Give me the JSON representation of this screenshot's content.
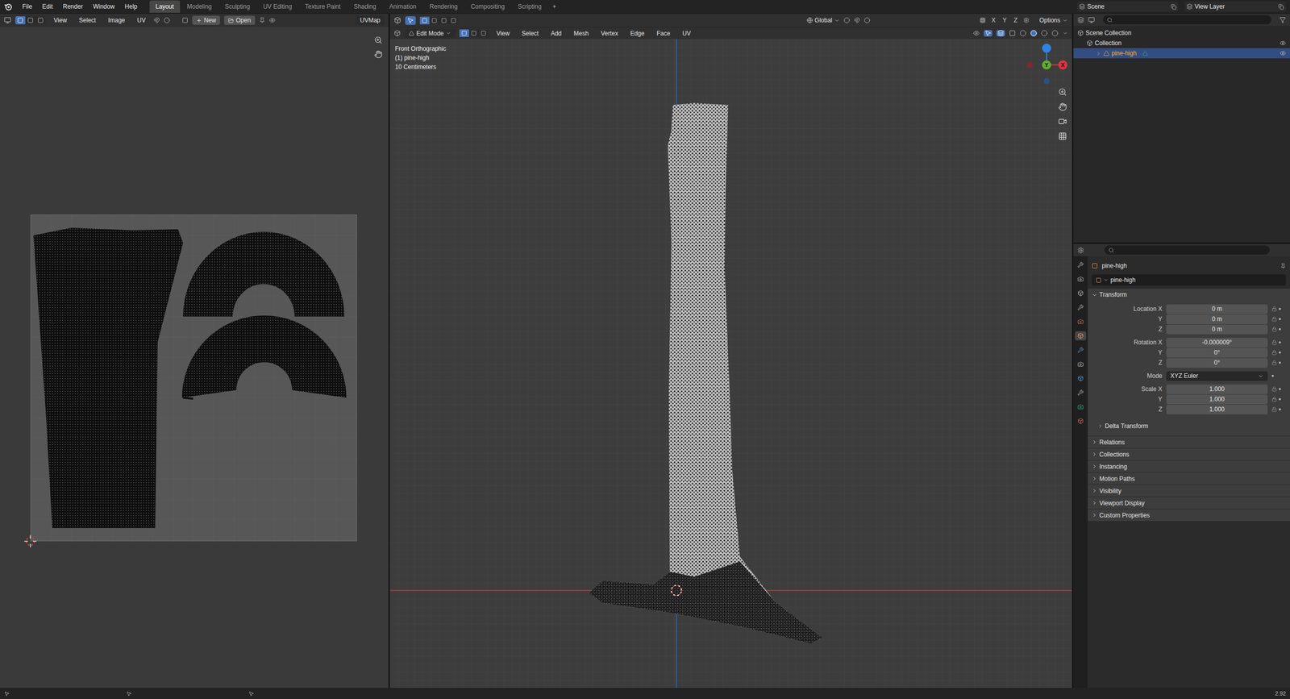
{
  "menu": [
    "File",
    "Edit",
    "Render",
    "Window",
    "Help"
  ],
  "workspaces": [
    {
      "label": "Layout",
      "selected": true
    },
    {
      "label": "Modeling",
      "selected": false
    },
    {
      "label": "Sculpting",
      "selected": false
    },
    {
      "label": "UV Editing",
      "selected": false
    },
    {
      "label": "Texture Paint",
      "selected": false
    },
    {
      "label": "Shading",
      "selected": false
    },
    {
      "label": "Animation",
      "selected": false
    },
    {
      "label": "Rendering",
      "selected": false
    },
    {
      "label": "Compositing",
      "selected": false
    },
    {
      "label": "Scripting",
      "selected": false
    }
  ],
  "add_workspace": "+",
  "scene": "Scene",
  "view_layer": "View Layer",
  "uv_editor": {
    "menu": [
      "View",
      "Select",
      "Image",
      "UV"
    ],
    "new_button": "New",
    "open_button": "Open",
    "uv_map": "UVMap"
  },
  "viewport": {
    "orientation": "Global",
    "mirror_axes": [
      "X",
      "Y",
      "Z"
    ],
    "options": "Options",
    "mode": "Edit Mode",
    "menu": [
      "View",
      "Select",
      "Add",
      "Mesh",
      "Vertex",
      "Edge",
      "Face",
      "UV"
    ],
    "overlay": [
      "Front Orthographic",
      "(1) pine-high",
      "10 Centimeters"
    ],
    "gizmo": [
      {
        "label": "Z",
        "color": "#2f84e3",
        "visible_label": false
      },
      {
        "label": "Y",
        "color": "#5fae2c",
        "visible_label": true
      },
      {
        "label": "X",
        "color": "#e0333f",
        "visible_label": true
      }
    ]
  },
  "outliner": {
    "items": [
      {
        "label": "Scene Collection",
        "depth": 0,
        "selected": false
      },
      {
        "label": "Collection",
        "depth": 1,
        "selected": false
      },
      {
        "label": "pine-high",
        "depth": 2,
        "selected": true
      }
    ]
  },
  "properties": {
    "object_name": "pine-high",
    "datablock": "pine-high",
    "transform": {
      "label": "Transform",
      "expanded": true,
      "rows": [
        {
          "label": "Location X",
          "value": "0 m",
          "kind": "field"
        },
        {
          "label": "Y",
          "value": "0 m",
          "kind": "field"
        },
        {
          "label": "Z",
          "value": "0 m",
          "kind": "field"
        },
        {
          "label": "Rotation X",
          "value": "-0.000009°",
          "kind": "field"
        },
        {
          "label": "Y",
          "value": "0°",
          "kind": "field"
        },
        {
          "label": "Z",
          "value": "0°",
          "kind": "field"
        },
        {
          "label": "Mode",
          "value": "XYZ Euler",
          "kind": "dropdown"
        },
        {
          "label": "Scale X",
          "value": "1.000",
          "kind": "field"
        },
        {
          "label": "Y",
          "value": "1.000",
          "kind": "field"
        },
        {
          "label": "Z",
          "value": "1.000",
          "kind": "field"
        }
      ]
    },
    "subsections": [
      {
        "label": "Delta Transform",
        "expanded": false
      }
    ],
    "sections": [
      {
        "label": "Relations",
        "expanded": false
      },
      {
        "label": "Collections",
        "expanded": false
      },
      {
        "label": "Instancing",
        "expanded": false
      },
      {
        "label": "Motion Paths",
        "expanded": false
      },
      {
        "label": "Visibility",
        "expanded": false
      },
      {
        "label": "Viewport Display",
        "expanded": false
      },
      {
        "label": "Custom Properties",
        "expanded": false
      }
    ]
  },
  "status_bar": {
    "version": "2.92"
  }
}
